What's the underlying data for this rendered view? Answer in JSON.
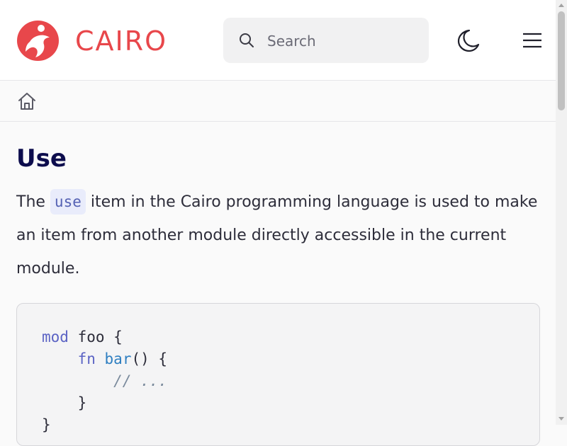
{
  "header": {
    "brand": "CAIRO",
    "brand_color": "#e8474b",
    "logo_icon": "cairo-logo-icon",
    "search": {
      "placeholder": "Search",
      "value": "",
      "icon": "search-icon"
    },
    "theme_toggle_icon": "moon-icon",
    "menu_icon": "hamburger-menu-icon"
  },
  "breadcrumb": {
    "home_icon": "home-icon"
  },
  "main": {
    "title": "Use",
    "intro_prefix": "The ",
    "intro_code": "use",
    "intro_suffix": " item in the Cairo programming language is used to make an item from another module directly accessible in the current module."
  },
  "code_example": {
    "line1_kw": "mod",
    "line1_rest": " foo {",
    "line2_indent": "    ",
    "line2_kw": "fn",
    "line2_fn": "bar",
    "line2_rest": "() {",
    "line3_indent": "        ",
    "line3_comment": "// ...",
    "line4": "    }",
    "line5": "}"
  },
  "colors": {
    "title": "#0d0d4d",
    "keyword": "#5b63c4",
    "function": "#2f7fc1",
    "inline_code_bg": "#e9ecfb"
  }
}
